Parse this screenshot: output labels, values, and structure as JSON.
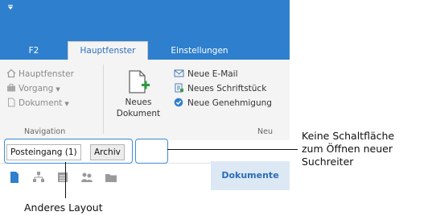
{
  "tabs": [
    {
      "label": "F2"
    },
    {
      "label": "Hauptfenster"
    },
    {
      "label": "Einstellungen"
    }
  ],
  "navigation": {
    "items": [
      {
        "label": "Hauptfenster"
      },
      {
        "label": "Vorgang"
      },
      {
        "label": "Dokument"
      }
    ],
    "group_label": "Navigation"
  },
  "neu": {
    "big_button_line1": "Neues",
    "big_button_line2": "Dokument",
    "commands": [
      {
        "label": "Neue E-Mail"
      },
      {
        "label": "Neues Schriftstück"
      },
      {
        "label": "Neue Genehmigung"
      }
    ],
    "group_label": "Neu"
  },
  "search_tabs": [
    {
      "label": "Posteingang (1)"
    },
    {
      "label": "Archiv"
    }
  ],
  "panel_title": "Dokumente",
  "annotations": {
    "right_line1": "Keine Schaltfläche",
    "right_line2": "zum Öffnen neuer",
    "right_line3": "Suchreiter",
    "bottom": "Anderes Layout"
  },
  "colors": {
    "accent": "#2e7fcd",
    "highlight": "#3d8fd6"
  }
}
